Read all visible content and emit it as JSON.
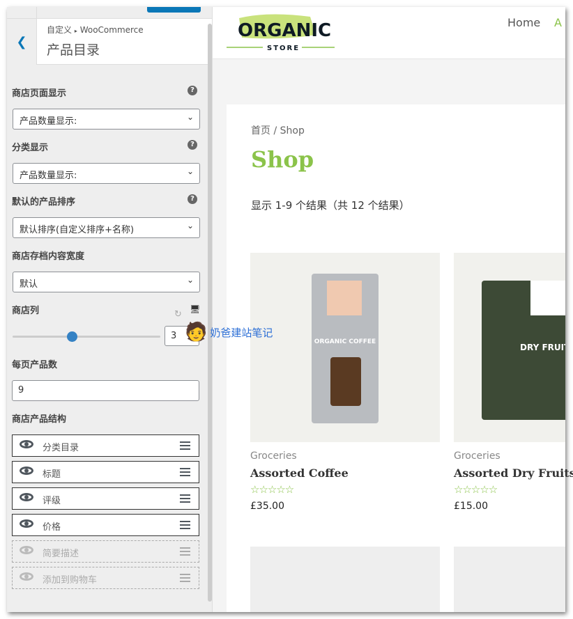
{
  "sidebar": {
    "breadcrumb_root": "自定义",
    "breadcrumb_sep": "▸",
    "breadcrumb_section": "WooCommerce",
    "title": "产品目录",
    "shop_page_display": {
      "label": "商店页面显示",
      "value": "产品数量显示:"
    },
    "category_display": {
      "label": "分类显示",
      "value": "产品数量显示:"
    },
    "default_sorting": {
      "label": "默认的产品排序",
      "value": "默认排序(自定义排序+名称)"
    },
    "archive_width": {
      "label": "商店存档内容宽度",
      "value": "默认"
    },
    "columns": {
      "label": "商店列",
      "value": "3",
      "slider_fraction": 0.4
    },
    "per_page": {
      "label": "每页产品数",
      "value": "9"
    },
    "structure": {
      "label": "商店产品结构",
      "items": [
        {
          "label": "分类目录",
          "visible": true
        },
        {
          "label": "标题",
          "visible": true
        },
        {
          "label": "评级",
          "visible": true
        },
        {
          "label": "价格",
          "visible": true
        },
        {
          "label": "简要描述",
          "visible": false
        },
        {
          "label": "添加到购物车",
          "visible": false
        }
      ]
    }
  },
  "watermark": "奶爸建站笔记",
  "site": {
    "logo_text": "ORGANIC",
    "logo_sub": "STORE",
    "nav": [
      "Home",
      "A"
    ],
    "breadcrumb": "首页 / Shop",
    "page_title": "Shop",
    "result_count": "显示 1-9 个结果（共 12 个结果）",
    "products": [
      {
        "category": "Groceries",
        "name": "Assorted Coffee",
        "rating_stars": "☆☆☆☆☆",
        "price": "£35.00",
        "bag_text": "ORGANIC COFFEE"
      },
      {
        "category": "Groceries",
        "name": "Assorted Dry Fruits",
        "rating_stars": "☆☆☆☆☆",
        "price": "£15.00",
        "bag_text": "DRY FRUITS"
      }
    ]
  },
  "colors": {
    "accent": "#8bc34a",
    "wp_blue": "#0a77b7"
  }
}
